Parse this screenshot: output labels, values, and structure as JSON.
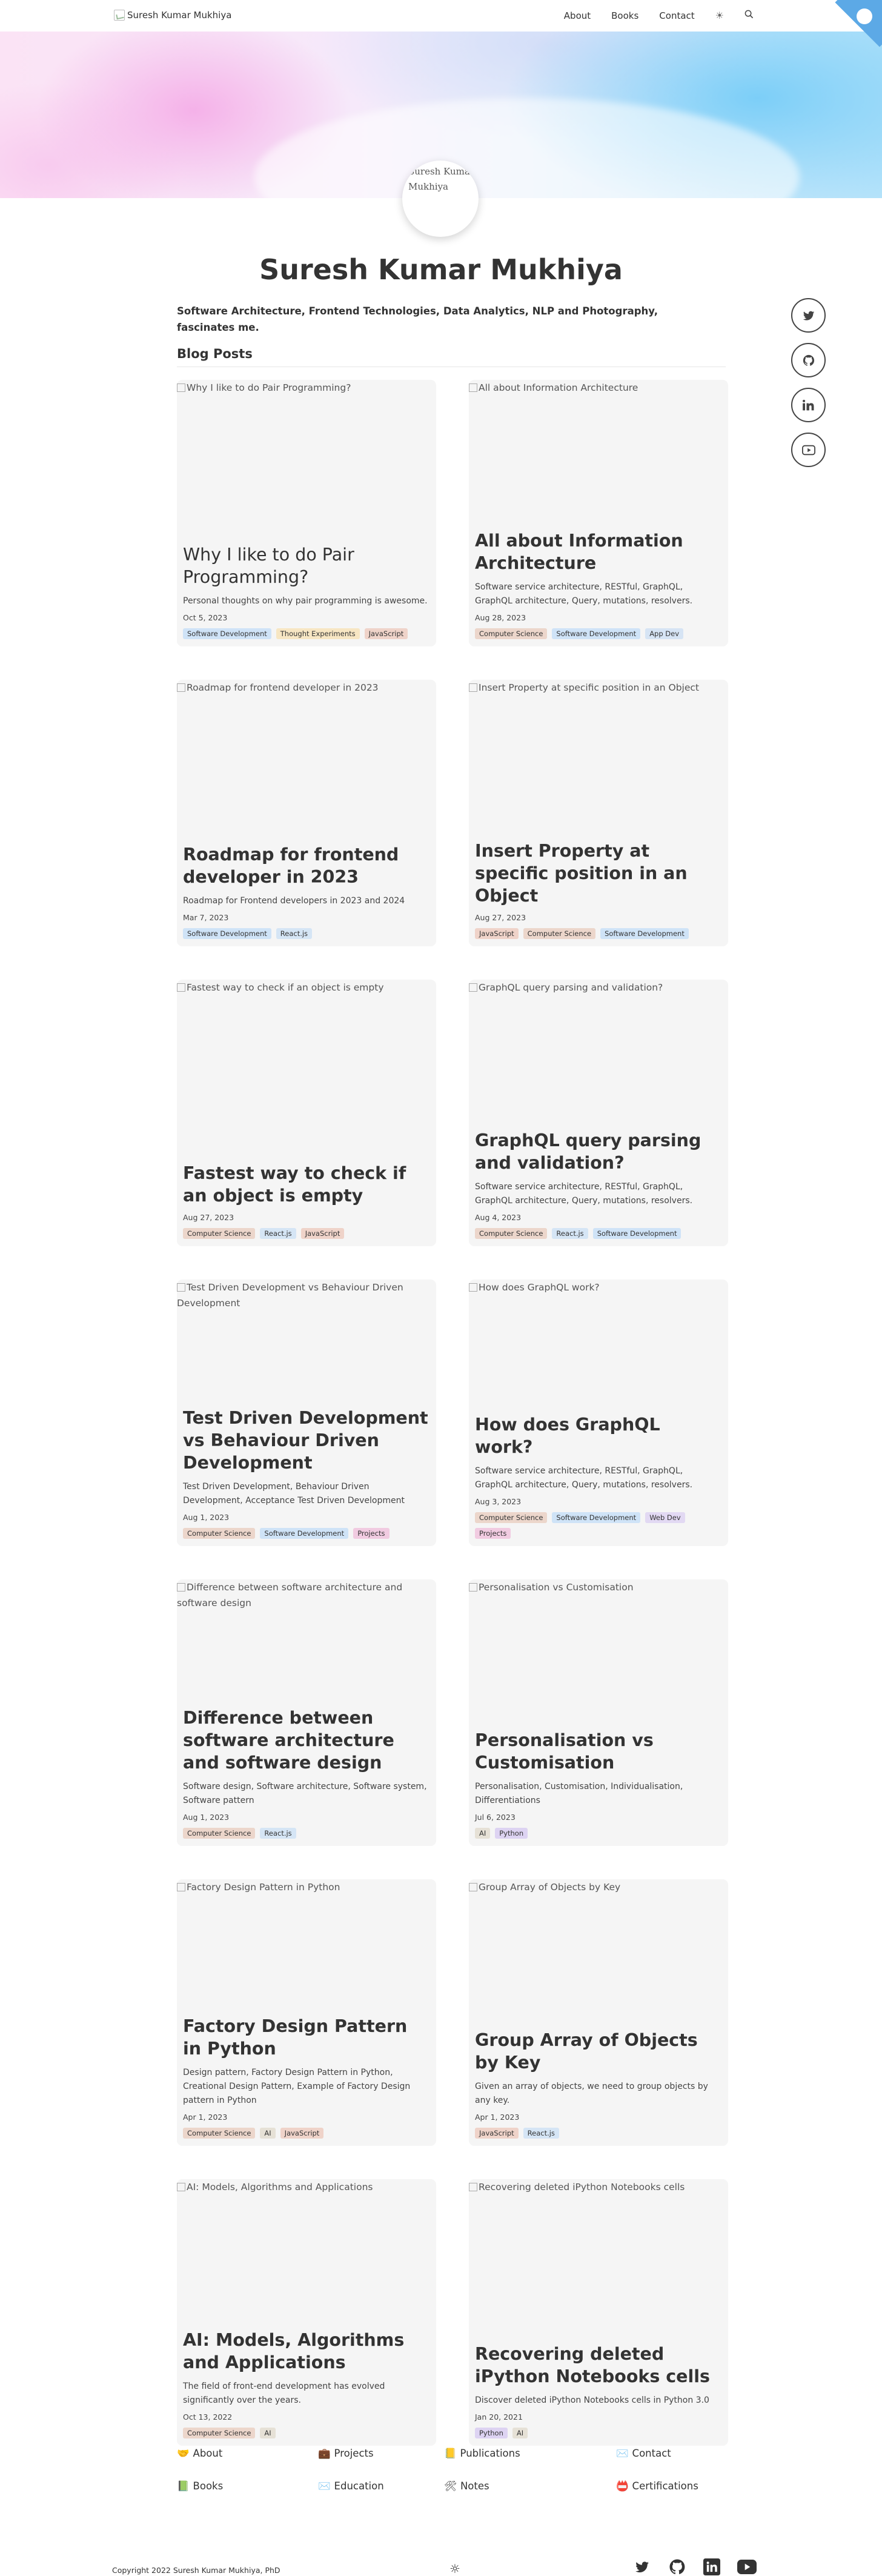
{
  "header": {
    "brand": "Suresh Kumar Mukhiya",
    "nav": [
      "About",
      "Books",
      "Contact"
    ],
    "theme_icon": "sun-icon",
    "search_icon": "search-icon"
  },
  "profile": {
    "avatar_alt": "Suresh Kumar Mukhiya",
    "name": "Suresh Kumar Mukhiya",
    "tagline": "Software Architecture, Frontend Technologies, Data Analytics, NLP and Photography, fascinates me."
  },
  "section_title": "Blog Posts",
  "posts": [
    {
      "img_alt": "Why I like to do Pair Programming?",
      "title": "Why I like to do Pair Programming?",
      "desc": "Personal thoughts on why pair programming is awesome.",
      "date": "Oct 5, 2023",
      "tags": [
        "Software Development",
        "Thought Experiments",
        "JavaScript"
      ]
    },
    {
      "img_alt": "All about Information Architecture",
      "title": "All about Information Architecture",
      "desc": "Software service architecture, RESTful, GraphQL, GraphQL architecture, Query, mutations, resolvers.",
      "date": "Aug 28, 2023",
      "tags": [
        "Computer Science",
        "Software Development",
        "App Dev"
      ]
    },
    {
      "img_alt": "Roadmap for frontend developer in 2023",
      "title": "Roadmap for frontend developer in 2023",
      "desc": "Roadmap for Frontend developers in 2023 and 2024",
      "date": "Mar 7, 2023",
      "tags": [
        "Software Development",
        "React.js"
      ]
    },
    {
      "img_alt": "Insert Property at specific position in an Object",
      "title": "Insert Property at specific position in an Object",
      "desc": "",
      "date": "Aug 27, 2023",
      "tags": [
        "JavaScript",
        "Computer Science",
        "Software Development"
      ]
    },
    {
      "img_alt": "Fastest way to check if an object is empty",
      "title": "Fastest way to check if an object is empty",
      "desc": "",
      "date": "Aug 27, 2023",
      "tags": [
        "Computer Science",
        "React.js",
        "JavaScript"
      ]
    },
    {
      "img_alt": "GraphQL query parsing and validation?",
      "title": "GraphQL query parsing and validation?",
      "desc": "Software service architecture, RESTful, GraphQL, GraphQL architecture, Query, mutations, resolvers.",
      "date": "Aug 4, 2023",
      "tags": [
        "Computer Science",
        "React.js",
        "Software Development"
      ]
    },
    {
      "img_alt": "Test Driven Development vs Behaviour Driven Development",
      "title": "Test Driven Development vs Behaviour Driven Development",
      "desc": "Test Driven Development, Behaviour Driven Development, Acceptance Test Driven Development",
      "date": "Aug 1, 2023",
      "tags": [
        "Computer Science",
        "Software Development",
        "Projects"
      ]
    },
    {
      "img_alt": "How does GraphQL work?",
      "title": "How does GraphQL work?",
      "desc": "Software service architecture, RESTful, GraphQL, GraphQL architecture, Query, mutations, resolvers.",
      "date": "Aug 3, 2023",
      "tags": [
        "Computer Science",
        "Software Development",
        "Web Dev",
        "Projects"
      ]
    },
    {
      "img_alt": "Difference between software architecture and software design",
      "title": "Difference between software architecture and software design",
      "desc": "Software design, Software architecture, Software system, Software pattern",
      "date": "Aug 1, 2023",
      "tags": [
        "Computer Science",
        "React.js"
      ]
    },
    {
      "img_alt": "Personalisation vs Customisation",
      "title": "Personalisation vs Customisation",
      "desc": "Personalisation, Customisation, Individualisation, Differentiations",
      "date": "Jul 6, 2023",
      "tags": [
        "AI",
        "Python"
      ]
    },
    {
      "img_alt": "Factory Design Pattern in Python",
      "title": "Factory Design Pattern in Python",
      "desc": "Design pattern, Factory Design Pattern in Python, Creational Design Pattern, Example of Factory Design pattern in Python",
      "date": "Apr 1, 2023",
      "tags": [
        "Computer Science",
        "AI",
        "JavaScript"
      ]
    },
    {
      "img_alt": "Group Array of Objects by Key",
      "title": "Group Array of Objects by Key",
      "desc": "Given an array of objects, we need to group objects by any key.",
      "date": "Apr 1, 2023",
      "tags": [
        "JavaScript",
        "React.js"
      ]
    },
    {
      "img_alt": "AI: Models, Algorithms and Applications",
      "title": "AI: Models, Algorithms and Applications",
      "desc": "The field of front-end development has evolved significantly over the years.",
      "date": "Oct 13, 2022",
      "tags": [
        "Computer Science",
        "AI"
      ]
    },
    {
      "img_alt": "Recovering deleted iPython Notebooks cells",
      "title": "Recovering deleted iPython Notebooks cells",
      "desc": "Discover deleted iPython Notebooks cells in Python 3.0",
      "date": "Jan 20, 2021",
      "tags": [
        "Python",
        "AI"
      ]
    }
  ],
  "footer_links": [
    {
      "icon": "🤝",
      "label": "About"
    },
    {
      "icon": "💼",
      "label": "Projects"
    },
    {
      "icon": "📒",
      "label": "Publications"
    },
    {
      "icon": "✉️",
      "label": "Contact"
    },
    {
      "icon": "📗",
      "label": "Books"
    },
    {
      "icon": "✉️",
      "label": "Education"
    },
    {
      "icon": "🛠",
      "label": "Notes"
    },
    {
      "icon": "📛",
      "label": "Certifications"
    }
  ],
  "copyright": "Copyright 2022 Suresh Kumar Mukhiya, PhD",
  "tag_colors": {
    "Software Development": "t-sd",
    "Thought Experiments": "t-te",
    "JavaScript": "t-js",
    "Computer Science": "t-cs",
    "App Dev": "t-ad",
    "React.js": "t-rj",
    "Projects": "t-pr",
    "Web Dev": "t-wd",
    "AI": "t-ai",
    "Python": "t-py"
  }
}
